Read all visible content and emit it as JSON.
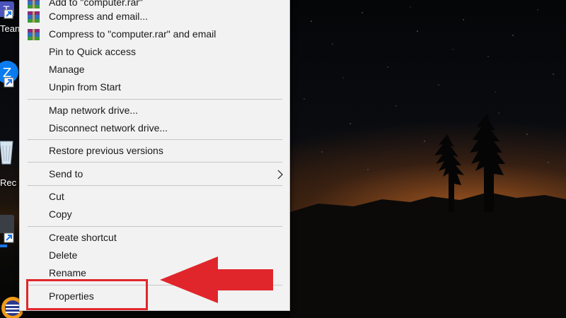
{
  "desktop": {
    "icons": [
      {
        "id": "teams",
        "label": "Tean"
      },
      {
        "id": "zalo",
        "label": ""
      },
      {
        "id": "recycle",
        "label": "Rec"
      },
      {
        "id": "app4",
        "label": ""
      },
      {
        "id": "app5",
        "label": ""
      }
    ]
  },
  "menu": {
    "items": [
      {
        "label": "Add to \"computer.rar\"",
        "icon": "winrar-icon"
      },
      {
        "label": "Compress and email...",
        "icon": "winrar-icon"
      },
      {
        "label": "Compress to \"computer.rar\" and email",
        "icon": "winrar-icon"
      },
      {
        "label": "Pin to Quick access"
      },
      {
        "label": "Manage"
      },
      {
        "label": "Unpin from Start"
      },
      {
        "label": "Map network drive..."
      },
      {
        "label": "Disconnect network drive..."
      },
      {
        "label": "Restore previous versions"
      },
      {
        "label": "Send to",
        "submenu": true
      },
      {
        "label": "Cut"
      },
      {
        "label": "Copy"
      },
      {
        "label": "Create shortcut"
      },
      {
        "label": "Delete"
      },
      {
        "label": "Rename"
      },
      {
        "label": "Properties"
      }
    ]
  },
  "annotation": {
    "color": "#e0262b",
    "target": "Properties"
  }
}
